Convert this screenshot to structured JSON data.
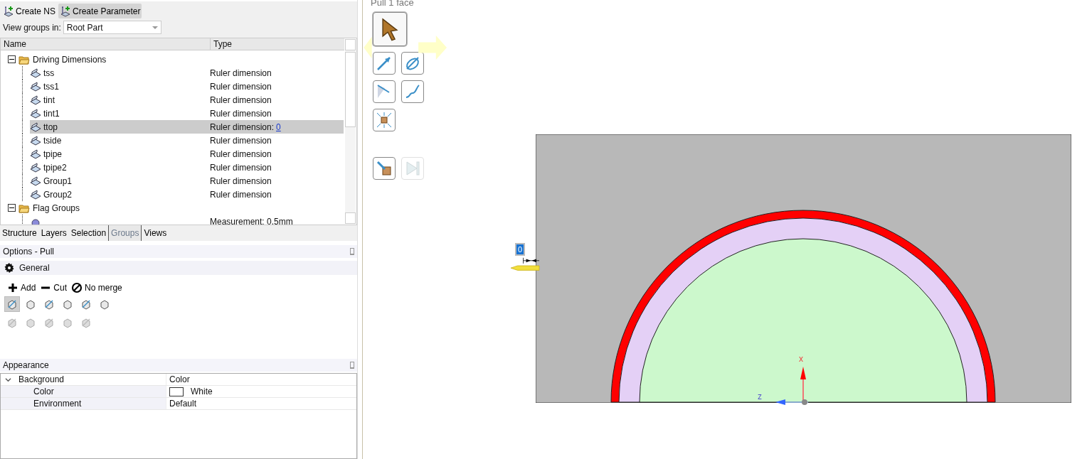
{
  "toolbar": {
    "buttons": [
      {
        "label": "Create NS",
        "selected": false
      },
      {
        "label": "Create Parameter",
        "selected": true
      }
    ]
  },
  "view_groups": {
    "label": "View groups in:",
    "value": "Root Part"
  },
  "tree": {
    "columns": [
      "Name",
      "Type"
    ],
    "items": [
      {
        "name": "Driving Dimensions",
        "expanded": true,
        "children": [
          {
            "name": "tss",
            "type": "Ruler dimension",
            "selected": false
          },
          {
            "name": "tss1",
            "type": "Ruler dimension",
            "selected": false
          },
          {
            "name": "tint",
            "type": "Ruler dimension",
            "selected": false
          },
          {
            "name": "tint1",
            "type": "Ruler dimension",
            "selected": false
          },
          {
            "name": "ttop",
            "type": "Ruler dimension:",
            "value": "0",
            "selected": true
          },
          {
            "name": "tside",
            "type": "Ruler dimension",
            "selected": false
          },
          {
            "name": "tpipe",
            "type": "Ruler dimension",
            "selected": false
          },
          {
            "name": "tpipe2",
            "type": "Ruler dimension",
            "selected": false
          },
          {
            "name": "Group1",
            "type": "Ruler dimension",
            "selected": false
          },
          {
            "name": "Group2",
            "type": "Ruler dimension",
            "selected": false
          }
        ]
      },
      {
        "name": "Flag Groups",
        "expanded": true,
        "children": [
          {
            "type": "Measurement: 0.5mm",
            "selected": false
          }
        ]
      }
    ]
  },
  "tabs": [
    {
      "label": "Structure",
      "selected": false
    },
    {
      "label": "Layers",
      "selected": false
    },
    {
      "label": "Selection",
      "selected": false
    },
    {
      "label": "Groups",
      "selected": true
    },
    {
      "label": "Views",
      "selected": false
    }
  ],
  "options": {
    "title": "Options - Pull",
    "section": "General",
    "modes": [
      "Add",
      "Cut",
      "No merge"
    ],
    "tools": [
      [
        {
          "selected": true,
          "disabled": false
        },
        {
          "selected": false,
          "disabled": false
        },
        {
          "selected": false,
          "disabled": false
        },
        {
          "selected": false,
          "disabled": false
        },
        {
          "selected": false,
          "disabled": false
        },
        {
          "selected": false,
          "disabled": false
        }
      ],
      [
        {
          "selected": false,
          "disabled": true
        },
        {
          "selected": false,
          "disabled": true
        },
        {
          "selected": false,
          "disabled": true
        },
        {
          "selected": false,
          "disabled": true
        },
        {
          "selected": false,
          "disabled": true
        }
      ]
    ]
  },
  "appearance": {
    "title": "Appearance",
    "rows": [
      {
        "name": "Background",
        "value": "Color",
        "expanded": true,
        "children": [
          {
            "name": "Color",
            "value": "White",
            "color": "#ffffff"
          },
          {
            "name": "Environment",
            "value": "Default"
          }
        ]
      }
    ]
  },
  "viewport": {
    "title": "Pull 1 face",
    "tools": [
      {
        "kind": "select",
        "selected": true,
        "disabled": false
      },
      {
        "kind": "direction",
        "selected": false,
        "disabled": false
      },
      {
        "kind": "revolve",
        "selected": false,
        "disabled": false
      },
      {
        "kind": "sweep",
        "selected": false,
        "disabled": false
      },
      {
        "kind": "path",
        "selected": false,
        "disabled": false
      },
      {
        "kind": "scale",
        "selected": false,
        "disabled": false
      },
      {
        "kind": "up-to",
        "selected": false,
        "disabled": false
      },
      {
        "kind": "complete",
        "selected": false,
        "disabled": true
      }
    ],
    "dimension": "0",
    "axes": [
      "x",
      "z"
    ]
  }
}
